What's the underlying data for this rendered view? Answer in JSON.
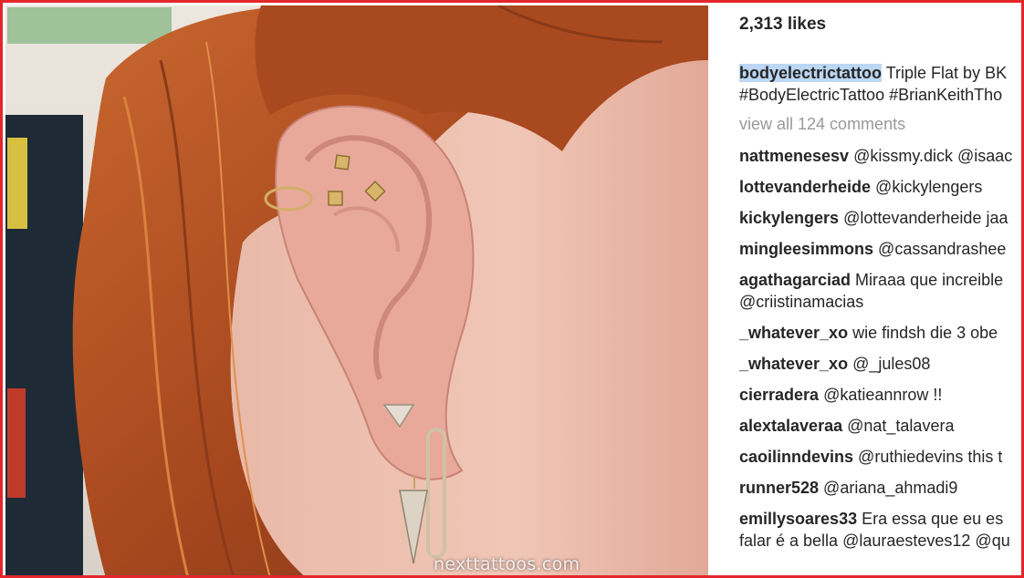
{
  "post": {
    "likes": "2,313 likes",
    "caption_user": "bodyelectrictattoo",
    "caption_line1": " Triple Flat by BK",
    "caption_line2": "#BodyElectricTattoo #BrianKeithTho",
    "view_all": "view all 124 comments"
  },
  "comments": [
    {
      "user": "nattmenesesv",
      "text": " @kissmy.dick @isaac",
      "cont": ""
    },
    {
      "user": "lottevanderheide",
      "text": " @kickylengers",
      "cont": ""
    },
    {
      "user": "kickylengers",
      "text": " @lottevanderheide jaa",
      "cont": ""
    },
    {
      "user": "mingleesimmons",
      "text": " @cassandrashee",
      "cont": ""
    },
    {
      "user": "agathagarciad",
      "text": " Miraaa que increible",
      "cont": "@criistinamacias"
    },
    {
      "user": "_whatever_xo",
      "text": " wie findsh die 3 obe",
      "cont": ""
    },
    {
      "user": "_whatever_xo",
      "text": " @_jules08",
      "cont": ""
    },
    {
      "user": "cierradera",
      "text": " @katieannrow !!",
      "cont": ""
    },
    {
      "user": "alextalaveraa",
      "text": " @nat_talavera",
      "cont": ""
    },
    {
      "user": "caoilinndevins",
      "text": " @ruthiedevins this t",
      "cont": ""
    },
    {
      "user": "runner528",
      "text": " @ariana_ahmadi9",
      "cont": ""
    },
    {
      "user": "emillysoares33",
      "text": " Era essa que eu es",
      "cont": "falar é a bella @lauraesteves12 @qu"
    }
  ],
  "watermark": "nexttattoos.com",
  "colors": {
    "frame_border": "#e3262b",
    "text": "#262626",
    "muted": "#999999",
    "highlight": "#bcd7f3",
    "hair": "#b8562a",
    "skin": "#e8b4a4"
  }
}
